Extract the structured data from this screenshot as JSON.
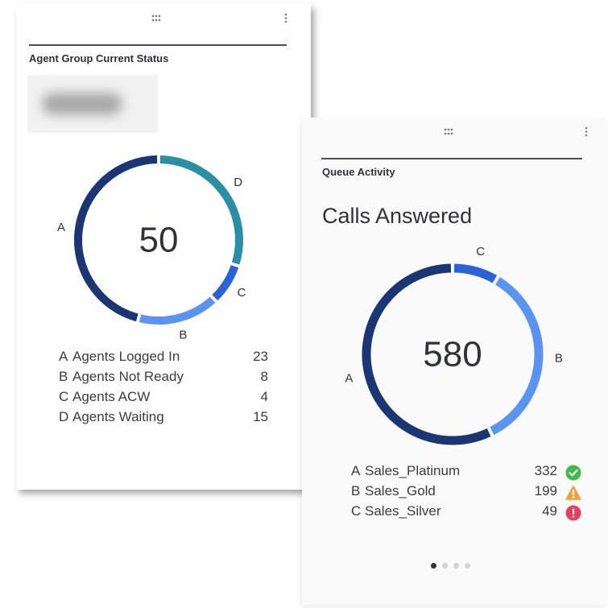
{
  "agent_group": {
    "title": "Agent Group Current Status",
    "total": "50",
    "chart_data": {
      "type": "pie",
      "title": "",
      "center_value": 50,
      "categories": [
        "A",
        "B",
        "C",
        "D"
      ],
      "values": [
        23,
        8,
        4,
        15
      ],
      "colors": [
        "#1c3574",
        "#5b93f1",
        "#2a63d8",
        "#2a8ea5"
      ]
    },
    "legend": [
      {
        "key": "A",
        "label": "Agents Logged In",
        "value": "23"
      },
      {
        "key": "B",
        "label": "Agents Not Ready",
        "value": "8"
      },
      {
        "key": "C",
        "label": "Agents ACW",
        "value": "4"
      },
      {
        "key": "D",
        "label": "Agents Waiting",
        "value": "15"
      }
    ]
  },
  "queue_activity": {
    "title": "Queue Activity",
    "heading": "Calls Answered",
    "total": "580",
    "chart_data": {
      "type": "pie",
      "title": "",
      "center_value": 580,
      "categories": [
        "A",
        "B",
        "C"
      ],
      "values": [
        332,
        199,
        49
      ],
      "colors": [
        "#1c3574",
        "#5b93f1",
        "#2a63d8"
      ]
    },
    "legend": [
      {
        "key": "A",
        "label": "Sales_Platinum",
        "value": "332",
        "status": "check-circle-icon",
        "status_color": "#43b94a"
      },
      {
        "key": "B",
        "label": "Sales_Gold",
        "value": "199",
        "status": "warning-triangle-icon",
        "status_color": "#f0a13a"
      },
      {
        "key": "C",
        "label": "Sales_Silver",
        "value": "49",
        "status": "error-circle-icon",
        "status_color": "#e5425f"
      }
    ],
    "pagination": {
      "pages": 4,
      "active": 1
    }
  },
  "colors": {
    "rule": "#4a4f55",
    "dot_active": "#2f3237",
    "dot_inactive": "#cdd3db"
  }
}
